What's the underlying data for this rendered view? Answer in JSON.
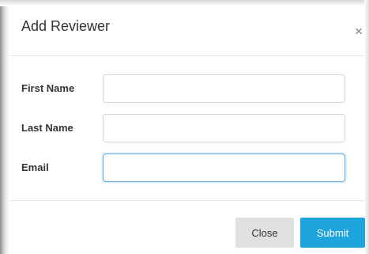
{
  "modal": {
    "title": "Add Reviewer",
    "close_icon": "close-icon",
    "close_glyph": "×"
  },
  "form": {
    "first_name": {
      "label": "First Name",
      "value": "",
      "placeholder": ""
    },
    "last_name": {
      "label": "Last Name",
      "value": "",
      "placeholder": ""
    },
    "email": {
      "label": "Email",
      "value": "",
      "placeholder": "",
      "focused": true
    }
  },
  "footer": {
    "close_label": "Close",
    "submit_label": "Submit"
  },
  "colors": {
    "submit_bg": "#1da4dc",
    "close_bg": "#e0e0e0",
    "focus_border": "#66afe9"
  }
}
